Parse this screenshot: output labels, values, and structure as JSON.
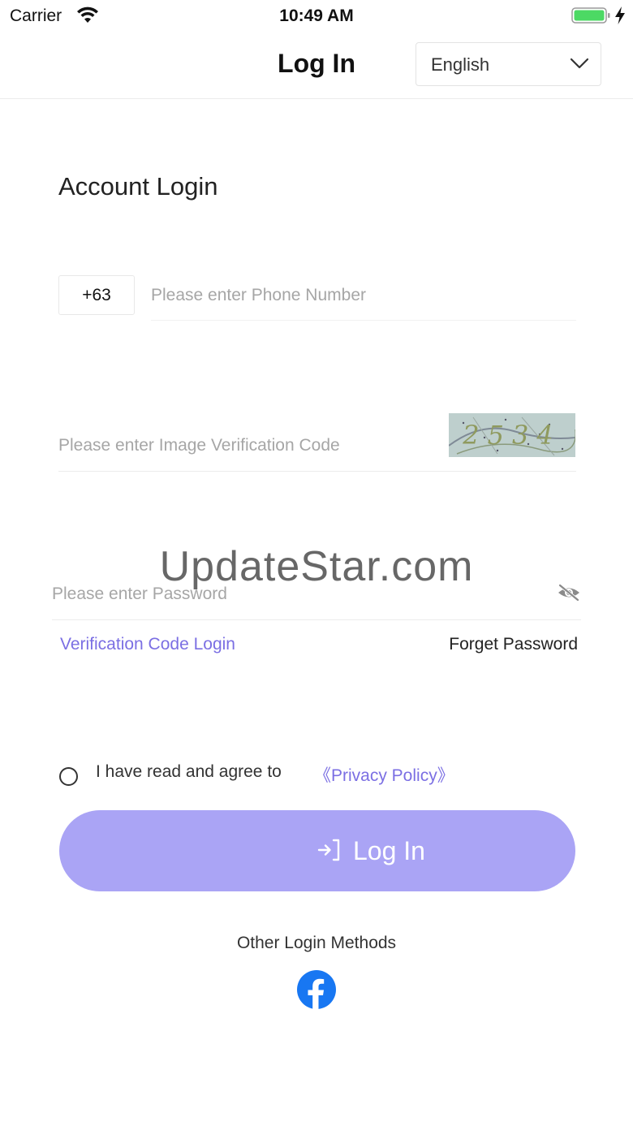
{
  "status_bar": {
    "carrier": "Carrier",
    "time": "10:49 AM",
    "icons": [
      "wifi-icon",
      "battery-icon",
      "charging-bolt-icon"
    ]
  },
  "nav": {
    "title": "Log In",
    "language": {
      "selected": "English",
      "icon": "chevron-down-icon"
    }
  },
  "form": {
    "section_title": "Account Login",
    "country_code": "+63",
    "phone_placeholder": "Please enter Phone Number",
    "image_code_placeholder": "Please enter Image Verification Code",
    "captcha_text": "2534",
    "password_placeholder": "Please enter Password",
    "password_toggle_icon": "eye-off-icon",
    "verification_code_login": "Verification Code Login",
    "forget_password": "Forget Password",
    "agree_text": "I have read and agree to",
    "privacy_policy": "《Privacy Policy》",
    "login_button": {
      "label": "Log In",
      "icon": "login-arrow-icon"
    },
    "other_methods": "Other Login Methods",
    "social_icons": [
      "facebook-icon"
    ]
  },
  "watermark": "UpdateStar.com",
  "colors": {
    "accent": "#7b6fe3",
    "button": "#aaa4f5",
    "facebook": "#1877f2",
    "battery": "#4cd964"
  }
}
